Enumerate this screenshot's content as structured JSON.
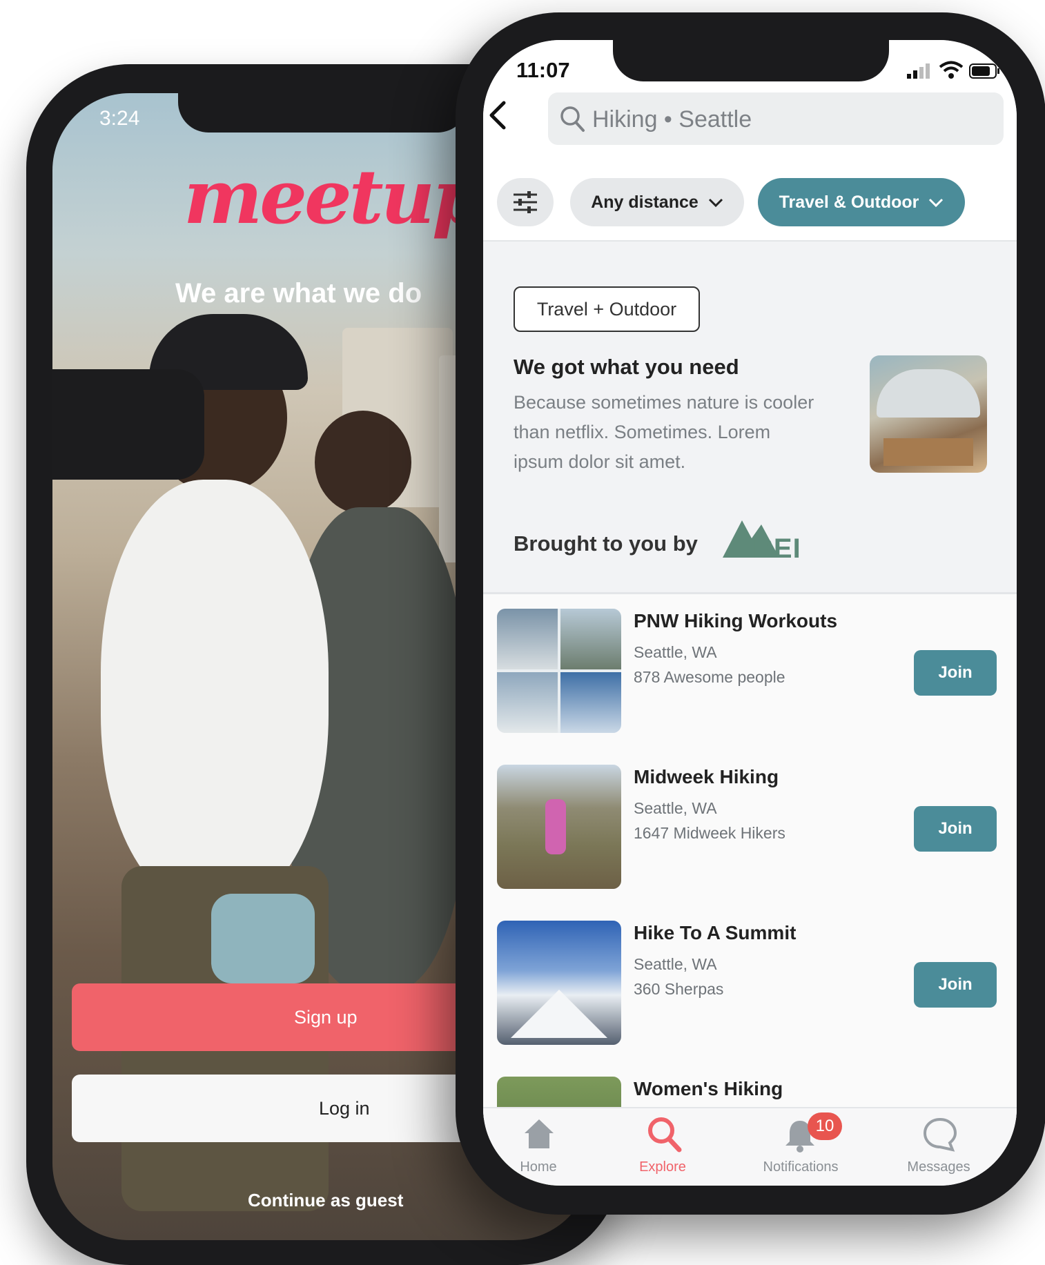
{
  "left_phone": {
    "status_time": "3:24",
    "logo_text": "meetup",
    "tagline": "We are what we do",
    "signup_label": "Sign up",
    "login_label": "Log in",
    "guest_label": "Continue as guest",
    "brand_color": "#f0636a"
  },
  "right_phone": {
    "status_time": "11:07",
    "search": {
      "placeholder": "Hiking • Seattle"
    },
    "filters": {
      "distance_label": "Any distance",
      "category_label": "Travel & Outdoor"
    },
    "promo": {
      "tag": "Travel + Outdoor",
      "title": "We got what you need",
      "body": "Because sometimes nature is cooler than netflix. Sometimes. Lorem ipsum dolor sit amet.",
      "sponsor_prefix": "Brought to you by",
      "sponsor_name": "REI"
    },
    "groups": [
      {
        "name": "PNW Hiking Workouts",
        "location": "Seattle, WA",
        "members": "878 Awesome people",
        "action": "Join"
      },
      {
        "name": "Midweek Hiking",
        "location": "Seattle, WA",
        "members": "1647 Midweek Hikers",
        "action": "Join"
      },
      {
        "name": "Hike To A Summit",
        "location": "Seattle, WA",
        "members": "360 Sherpas",
        "action": "Join"
      },
      {
        "name": "Women's Hiking"
      }
    ],
    "tabbar": {
      "home": "Home",
      "explore": "Explore",
      "notifications": "Notifications",
      "notifications_badge": "10",
      "messages": "Messages"
    },
    "accent_color": "#4b8c99"
  }
}
